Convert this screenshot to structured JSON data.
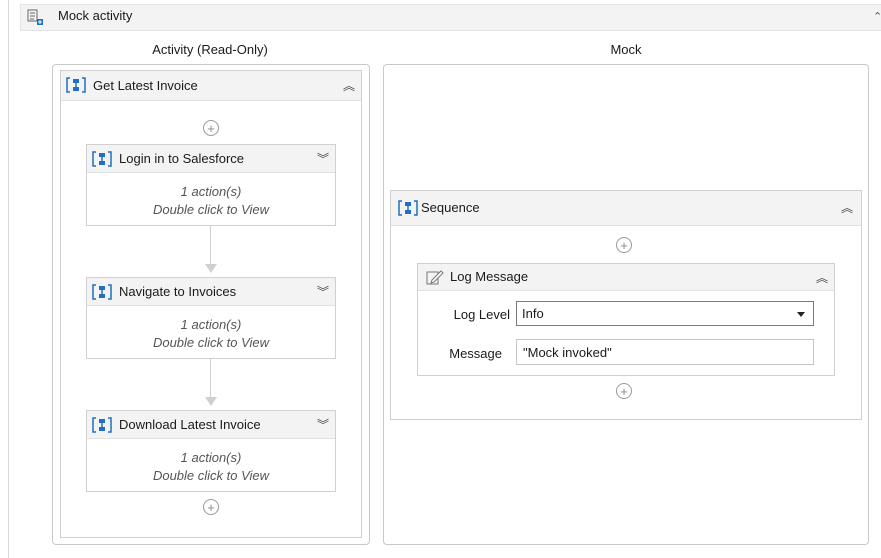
{
  "header": {
    "title": "Mock activity"
  },
  "columns": {
    "left_title": "Activity (Read-Only)",
    "right_title": "Mock"
  },
  "left": {
    "sequence_title": "Get Latest Invoice",
    "activities": [
      {
        "title": "Login in to Salesforce",
        "line1": "1 action(s)",
        "line2": "Double click to View"
      },
      {
        "title": "Navigate to Invoices",
        "line1": "1 action(s)",
        "line2": "Double click to View"
      },
      {
        "title": "Download Latest Invoice",
        "line1": "1 action(s)",
        "line2": "Double click to View"
      }
    ]
  },
  "right": {
    "sequence_title": "Sequence",
    "log": {
      "title": "Log Message",
      "level_label": "Log Level",
      "level_value": "Info",
      "message_label": "Message",
      "message_value": "\"Mock invoked\""
    }
  },
  "icons": {
    "header": "mock-activity-icon",
    "sequence": "sequence-icon",
    "log": "log-message-icon",
    "collapse": "chevron-double-up-icon",
    "expand": "chevron-double-down-icon",
    "add": "add-activity-icon"
  },
  "colors": {
    "accent": "#1f6fc5",
    "header_bg": "#f3f3f3",
    "border": "#c9c9c9"
  }
}
